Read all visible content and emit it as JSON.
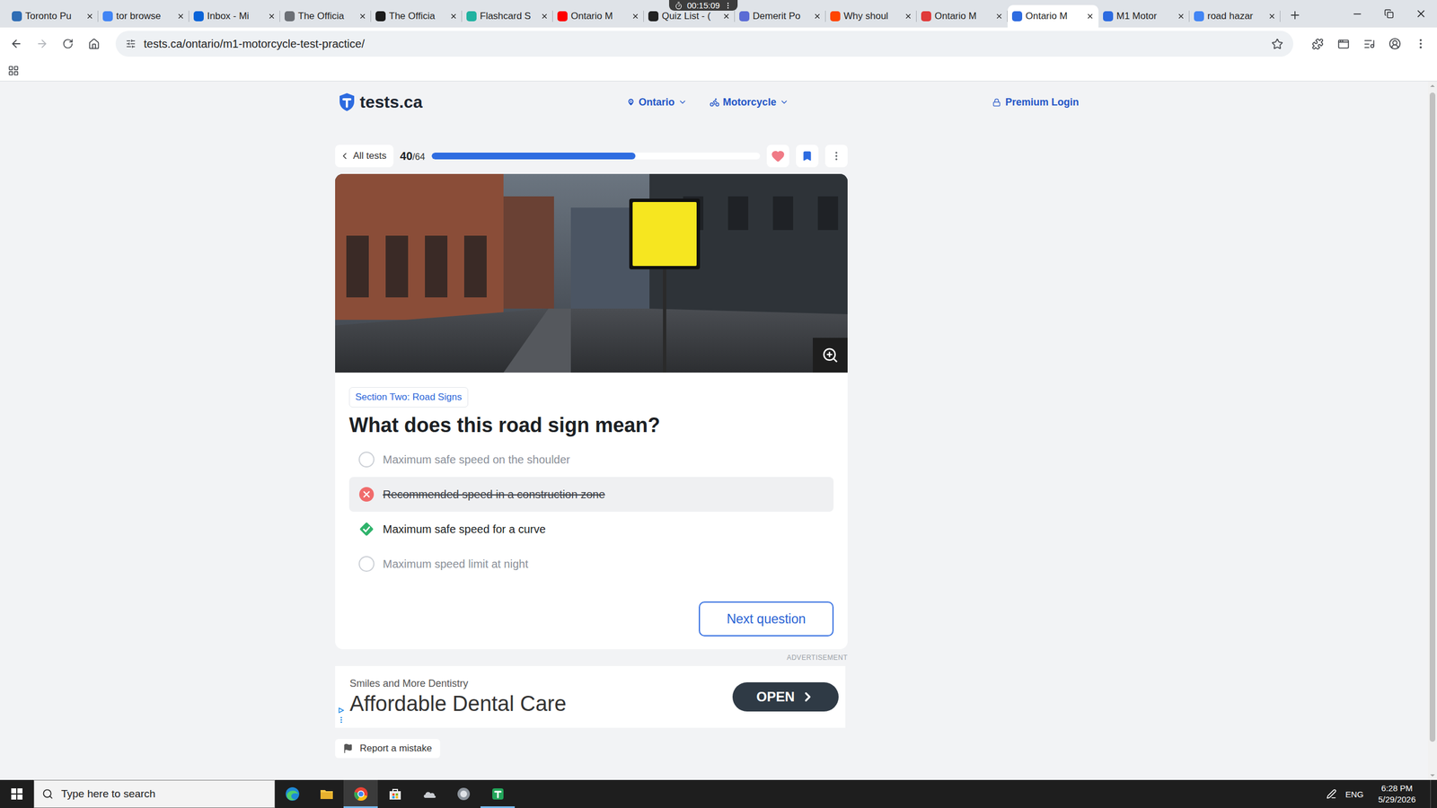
{
  "browser": {
    "tabs": [
      {
        "label": "Toronto Pu",
        "selected": false,
        "color": "#2f6db5"
      },
      {
        "label": "tor browse",
        "selected": false,
        "color": "#4285f4"
      },
      {
        "label": "Inbox - Mi",
        "selected": false,
        "color": "#0a64d8"
      },
      {
        "label": "The Officia",
        "selected": false,
        "color": "#6b6f75"
      },
      {
        "label": "The Officia",
        "selected": false,
        "color": "#1b1b1b"
      },
      {
        "label": "Flashcard S",
        "selected": false,
        "color": "#20b2a0"
      },
      {
        "label": "Ontario M",
        "selected": false,
        "color": "#ff0000"
      },
      {
        "label": "Quiz List - (",
        "selected": false,
        "color": "#222222"
      },
      {
        "label": "Demerit Po",
        "selected": false,
        "color": "#5b6bd5"
      },
      {
        "label": "Why shoul",
        "selected": false,
        "color": "#ff4500"
      },
      {
        "label": "Ontario M",
        "selected": false,
        "color": "#e03a3a"
      },
      {
        "label": "Ontario M",
        "selected": true,
        "color": "#2d6be0"
      },
      {
        "label": "M1 Motor",
        "selected": false,
        "color": "#2d6be0"
      },
      {
        "label": "road hazar",
        "selected": false,
        "color": "#4285f4"
      }
    ],
    "timer": "00:15:09",
    "url": "tests.ca/ontario/m1-motorcycle-test-practice/",
    "starred": false
  },
  "site": {
    "logo": "tests.ca",
    "nav": [
      {
        "label": "Ontario",
        "kind": "location"
      },
      {
        "label": "Motorcycle",
        "kind": "vehicle"
      }
    ],
    "login": "Premium Login"
  },
  "quiz": {
    "back": "All tests",
    "current": "40",
    "total": "/64",
    "level": 0.62,
    "favorite": true,
    "bookmarked": true,
    "section": "Section Two: Road Signs",
    "question": "What does this road sign mean?",
    "options": [
      {
        "label": "Maximum safe speed on the shoulder",
        "selected": false,
        "correct": false
      },
      {
        "label": "Recommended speed in a construction zone",
        "selected": true,
        "correct": false
      },
      {
        "label": "Maximum safe speed for a curve",
        "selected": false,
        "correct": true
      },
      {
        "label": "Maximum speed limit at night",
        "selected": false,
        "correct": false
      }
    ],
    "next": "Next question"
  },
  "ad": {
    "label": "ADVERTISEMENT",
    "advertiser": "Smiles and More Dentistry",
    "headline": "Affordable Dental Care",
    "cta": "OPEN"
  },
  "report": "Report a mistake",
  "taskbar": {
    "search": "Type here to search",
    "apps": [
      {
        "kind": "edge",
        "selected": false,
        "running": false
      },
      {
        "kind": "explorer",
        "selected": false,
        "running": false
      },
      {
        "kind": "chrome",
        "selected": true,
        "running": true
      },
      {
        "kind": "store",
        "selected": false,
        "running": false
      },
      {
        "kind": "cloud",
        "selected": false,
        "running": false
      },
      {
        "kind": "shield",
        "selected": false,
        "running": false
      },
      {
        "kind": "sheets",
        "selected": false,
        "running": true
      }
    ],
    "language": "ENG",
    "time": "6:28 PM",
    "date": "5/29/2026"
  }
}
